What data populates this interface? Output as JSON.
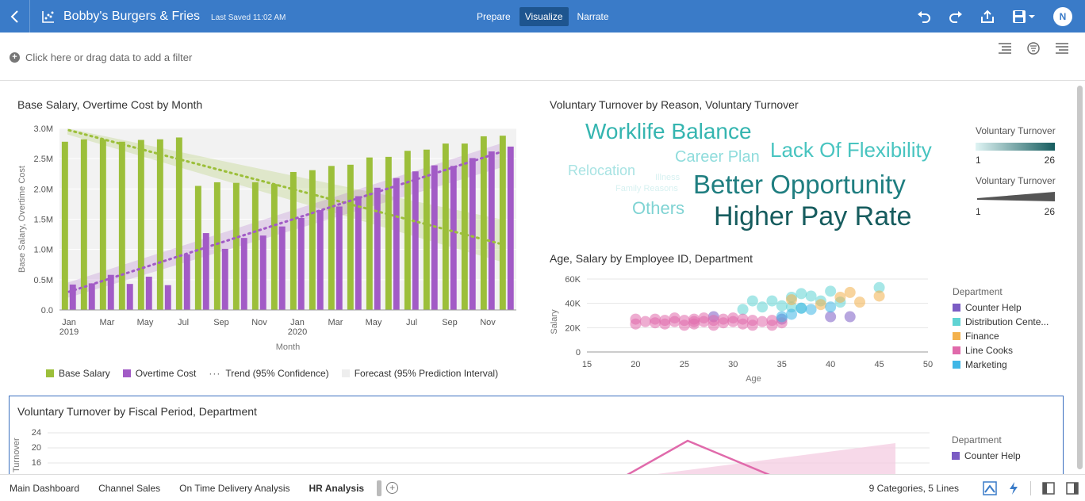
{
  "header": {
    "title": "Bobby's Burgers & Fries",
    "last_saved": "Last Saved 11:02 AM",
    "modes": [
      "Prepare",
      "Visualize",
      "Narrate"
    ],
    "active_mode": "Visualize",
    "avatar_initial": "N",
    "accent": "#3a7bc8"
  },
  "filter_bar": {
    "placeholder": "Click here or drag data to add a filter"
  },
  "chart_data": [
    {
      "id": "salary",
      "type": "bar",
      "title": "Base Salary, Overtime Cost by Month",
      "xlabel": "Month",
      "ylabel": "Base Salary, Overtime Cost",
      "ylim": [
        0,
        3000000
      ],
      "yticks": [
        "0.0",
        "0.5M",
        "1.0M",
        "1.5M",
        "2.0M",
        "2.5M",
        "3.0M"
      ],
      "xticks": [
        {
          "i": 0,
          "label": "Jan",
          "sub": "2019"
        },
        {
          "i": 2,
          "label": "Mar",
          "sub": ""
        },
        {
          "i": 4,
          "label": "May",
          "sub": ""
        },
        {
          "i": 6,
          "label": "Jul",
          "sub": ""
        },
        {
          "i": 8,
          "label": "Sep",
          "sub": ""
        },
        {
          "i": 10,
          "label": "Nov",
          "sub": ""
        },
        {
          "i": 12,
          "label": "Jan",
          "sub": "2020"
        },
        {
          "i": 14,
          "label": "Mar",
          "sub": ""
        },
        {
          "i": 16,
          "label": "May",
          "sub": ""
        },
        {
          "i": 18,
          "label": "Jul",
          "sub": ""
        },
        {
          "i": 20,
          "label": "Sep",
          "sub": ""
        },
        {
          "i": 22,
          "label": "Nov",
          "sub": ""
        }
      ],
      "series": [
        {
          "name": "Base Salary",
          "color": "#9cbf3a",
          "values": [
            2780000,
            2820000,
            2820000,
            2780000,
            2810000,
            2820000,
            2850000,
            2050000,
            2110000,
            2100000,
            2110000,
            2080000,
            2280000,
            2310000,
            2380000,
            2400000,
            2520000,
            2530000,
            2630000,
            2650000,
            2750000,
            2750000,
            2870000,
            2880000
          ]
        },
        {
          "name": "Overtime Cost",
          "color": "#a25bc6",
          "values": [
            420000,
            440000,
            580000,
            430000,
            550000,
            410000,
            920000,
            1270000,
            1010000,
            1190000,
            1230000,
            1380000,
            1520000,
            1650000,
            1710000,
            1880000,
            2020000,
            2180000,
            2290000,
            2390000,
            2380000,
            2510000,
            2620000,
            2700000
          ]
        }
      ],
      "trend": {
        "salary": [
          2970000,
          1100000
        ],
        "overtime": [
          300000,
          2600000
        ]
      },
      "legend": [
        "Base Salary",
        "Overtime Cost",
        "Trend (95% Confidence)",
        "Forecast (95% Prediction Interval)"
      ]
    },
    {
      "id": "scatter",
      "type": "scatter",
      "title": "Age, Salary by Employee ID, Department",
      "xlabel": "Age",
      "ylabel": "Salary",
      "xlim": [
        15,
        50
      ],
      "ylim": [
        0,
        60000
      ],
      "xticks": [
        15,
        20,
        25,
        30,
        35,
        40,
        45,
        50
      ],
      "yticks": [
        "0",
        "20K",
        "40K",
        "60K"
      ],
      "legend_title": "Department",
      "series": [
        {
          "name": "Counter Help",
          "color": "#7b5cc4",
          "points": [
            [
              40,
              29000
            ],
            [
              42,
              29000
            ],
            [
              28,
              29000
            ],
            [
              35,
              27000
            ]
          ]
        },
        {
          "name": "Distribution Cente...",
          "color": "#5fd3d3",
          "points": [
            [
              32,
              42000
            ],
            [
              34,
              42000
            ],
            [
              35,
              38000
            ],
            [
              36,
              45000
            ],
            [
              37,
              48000
            ],
            [
              38,
              46000
            ],
            [
              39,
              42000
            ],
            [
              40,
              50000
            ],
            [
              41,
              41000
            ],
            [
              45,
              53000
            ],
            [
              31,
              35000
            ],
            [
              36,
              37000
            ],
            [
              37,
              36000
            ],
            [
              33,
              37000
            ]
          ]
        },
        {
          "name": "Finance",
          "color": "#f3b14c",
          "points": [
            [
              36,
              43000
            ],
            [
              39,
              39000
            ],
            [
              41,
              45000
            ],
            [
              42,
              49000
            ],
            [
              43,
              41000
            ],
            [
              45,
              46000
            ]
          ]
        },
        {
          "name": "Line Cooks",
          "color": "#e06aab",
          "points": [
            [
              20,
              27000
            ],
            [
              21,
              25000
            ],
            [
              22,
              27000
            ],
            [
              23,
              26000
            ],
            [
              24,
              25000
            ],
            [
              25,
              26000
            ],
            [
              25,
              22000
            ],
            [
              26,
              27000
            ],
            [
              27,
              25000
            ],
            [
              28,
              26000
            ],
            [
              29,
              24000
            ],
            [
              30,
              25000
            ],
            [
              30,
              28000
            ],
            [
              31,
              23000
            ],
            [
              32,
              26000
            ],
            [
              33,
              25000
            ],
            [
              34,
              26000
            ],
            [
              35,
              24000
            ],
            [
              22,
              24000
            ],
            [
              24,
              28000
            ],
            [
              26,
              23000
            ],
            [
              28,
              22000
            ],
            [
              29,
              27000
            ],
            [
              32,
              22000
            ],
            [
              27,
              28000
            ],
            [
              23,
              23000
            ],
            [
              20,
              23000
            ],
            [
              26,
              25000
            ],
            [
              31,
              27000
            ],
            [
              34,
              22000
            ]
          ]
        },
        {
          "name": "Marketing",
          "color": "#3fb6e6",
          "points": [
            [
              35,
              29000
            ],
            [
              36,
              31000
            ],
            [
              38,
              35000
            ],
            [
              37,
              36000
            ],
            [
              40,
              37000
            ]
          ]
        }
      ]
    },
    {
      "id": "turnover",
      "type": "line",
      "title": "Voluntary Turnover by Fiscal Period, Department",
      "ylabel": "Turnover",
      "yticks": [
        "16",
        "20",
        "24"
      ],
      "legend_title": "Department",
      "legend": [
        "Counter Help"
      ]
    }
  ],
  "word_cloud": {
    "title": "Voluntary Turnover by Reason, Voluntary Turnover",
    "words": [
      {
        "text": "Worklife Balance",
        "color": "#35b5b0"
      },
      {
        "text": "Career Plan",
        "color": "#8fdcdc"
      },
      {
        "text": "Lack Of Flexibility",
        "color": "#48c4c0"
      },
      {
        "text": "Relocation",
        "color": "#a8e3e3"
      },
      {
        "text": "Illness",
        "color": "#d7f1f1"
      },
      {
        "text": "Family Reasons",
        "color": "#d7f1f1"
      },
      {
        "text": "Better Opportunity",
        "color": "#1f7e80"
      },
      {
        "text": "Others",
        "color": "#7fd3d3"
      },
      {
        "text": "Higher Pay Rate",
        "color": "#165c5e"
      }
    ],
    "legend": {
      "title1": "Voluntary Turnover",
      "min1": "1",
      "max1": "26",
      "title2": "Voluntary Turnover",
      "min2": "1",
      "max2": "26"
    }
  },
  "status": {
    "summary": "9 Categories, 5 Lines"
  },
  "tabs": [
    {
      "label": "Main Dashboard"
    },
    {
      "label": "Channel Sales"
    },
    {
      "label": "On Time Delivery Analysis"
    },
    {
      "label": "HR Analysis"
    }
  ],
  "active_tab": "HR Analysis"
}
